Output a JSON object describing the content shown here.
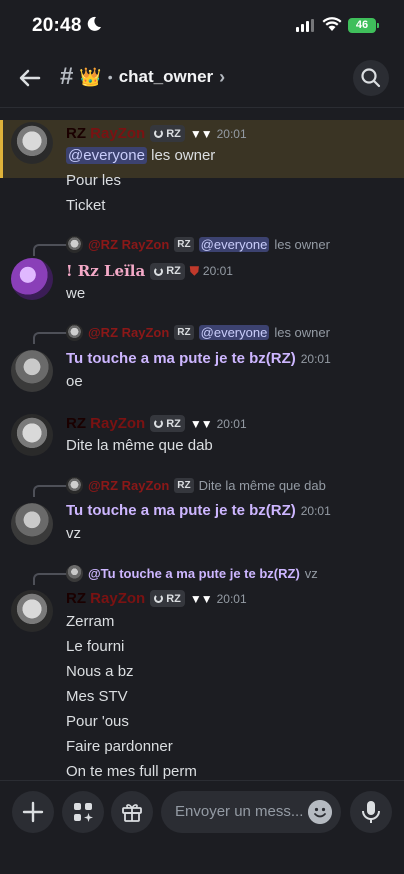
{
  "status": {
    "time": "20:48",
    "battery": "46"
  },
  "header": {
    "channel_emoji": "👑",
    "channel_name": "chat_owner"
  },
  "messages": [
    {
      "author": "RayZon",
      "author_prefix": "RZ",
      "tag": "RZ",
      "time": "20:01",
      "lines": [
        "@everyone",
        "les owner",
        "Pour les",
        "Ticket"
      ]
    },
    {
      "reply": {
        "name": "@RZ RayZon",
        "tag": "RZ",
        "mention": "@everyone",
        "text": "les owner"
      },
      "author": "! Rz Leïla",
      "tag": "RZ",
      "time": "20:01",
      "lines": [
        "we"
      ]
    },
    {
      "reply": {
        "name": "@RZ RayZon",
        "tag": "RZ",
        "mention": "@everyone",
        "text": "les owner"
      },
      "author": "Tu touche a ma pute je te bz(RZ)",
      "time": "20:01",
      "lines": [
        "oe"
      ]
    },
    {
      "author": "RayZon",
      "author_prefix": "RZ",
      "tag": "RZ",
      "time": "20:01",
      "lines": [
        "Dite la même que dab"
      ]
    },
    {
      "reply": {
        "name": "@RZ RayZon",
        "tag": "RZ",
        "text": "Dite la même que dab"
      },
      "author": "Tu touche a ma pute je te bz(RZ)",
      "time": "20:01",
      "lines": [
        "vz"
      ]
    },
    {
      "reply": {
        "name": "@Tu touche a ma pute je te bz(RZ)",
        "text": "vz"
      },
      "author": "RayZon",
      "author_prefix": "RZ",
      "tag": "RZ",
      "time": "20:01",
      "lines": [
        "Zerram",
        "Le fourni",
        "Nous a bz",
        "Mes STV",
        "Pour 'ous",
        "Faire pardonner",
        "On te mes full perm"
      ]
    }
  ],
  "composer": {
    "placeholder": "Envoyer un mess..."
  },
  "colors": {
    "background": "#1c1d22",
    "mention_bg": "#3c4270",
    "highlight": "#3a3424",
    "highlight_bar": "#e0b33a"
  }
}
